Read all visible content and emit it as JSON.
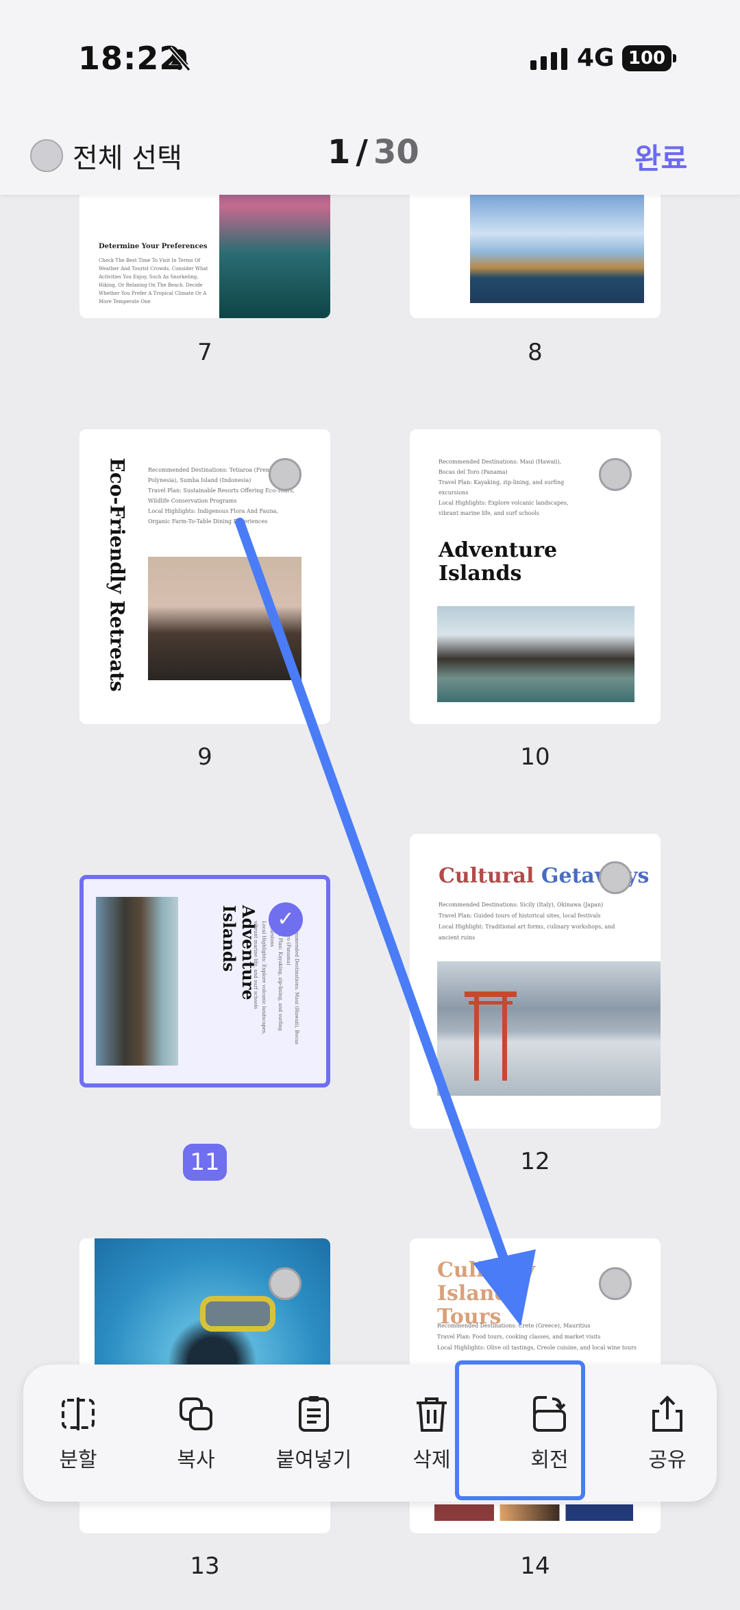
{
  "status_bar": {
    "time": "18:22",
    "network": "4G",
    "battery": "100"
  },
  "header": {
    "select_all": "전체 선택",
    "current_page": "1",
    "slash": "/",
    "total_pages": "30",
    "done": "완료"
  },
  "pages": {
    "p7": {
      "label": "7",
      "heading": "Determine Your Preferences",
      "body": "Check The Best Time To Visit In Terms Of Weather And Tourist Crowds. Consider What Activities You Enjoy, Such As Snorkeling, Hiking, Or Relaxing On The Beach. Decide Whether You Prefer A Tropical Climate Or A More Temperate One"
    },
    "p8": {
      "label": "8"
    },
    "p9": {
      "label": "9",
      "title": "Eco-Friendly Retreats",
      "body": "Recommended Destinations: Tetiaroa (French Polynesia), Sumba Island (Indonesia)\nTravel Plan: Sustainable Resorts Offering Eco-Tours, Wildlife Conservation Programs\nLocal Highlights: Indigenous Flora And Fauna, Organic Farm-To-Table Dining Experiences"
    },
    "p10": {
      "label": "10",
      "title": "Adventure Islands",
      "body": "Recommended Destinations: Maui (Hawaii), Bocas del Toro (Panama)\nTravel Plan: Kayaking, zip-lining, and surfing excursions\nLocal Highlights: Explore volcanic landscapes, vibrant marine life, and surf schools"
    },
    "p11": {
      "label": "11",
      "title": "Adventure Islands",
      "body": "Recommended Destinations: Maui (Hawaii), Bocas del Toro (Panama)\nTravel Plan: Kayaking, zip-lining, and surfing excursions\nLocal Highlights: Explore volcanic landscapes, vibrant marine life, and surf schools"
    },
    "p12": {
      "label": "12",
      "title_a": "Cultural",
      "title_b": "Getaways",
      "body": "Recommended Destinations: Sicily (Italy), Okinawa (Japan)\nTravel Plan: Guided tours of historical sites, local festivals\nLocal Highlight: Traditional art forms, culinary workshops, and ancient ruins"
    },
    "p13": {
      "label": "13"
    },
    "p14": {
      "label": "14",
      "title_a": "Culinary",
      "title_b": "Island Tours",
      "body": "Recommended Destinations: Crete (Greece), Mauritius\nTravel Plan: Food tours, cooking classes, and market visits\nLocal Highlights: Olive oil tastings, Creole cuisine, and local wine tours"
    }
  },
  "toolbar": [
    {
      "label": "분할",
      "icon": "split-icon"
    },
    {
      "label": "복사",
      "icon": "copy-icon"
    },
    {
      "label": "붙여넣기",
      "icon": "paste-icon"
    },
    {
      "label": "삭제",
      "icon": "trash-icon"
    },
    {
      "label": "회전",
      "icon": "rotate-icon"
    },
    {
      "label": "공유",
      "icon": "share-icon"
    }
  ],
  "colors": {
    "accent": "#6f6ff0",
    "annotation": "#4a7cf7"
  }
}
